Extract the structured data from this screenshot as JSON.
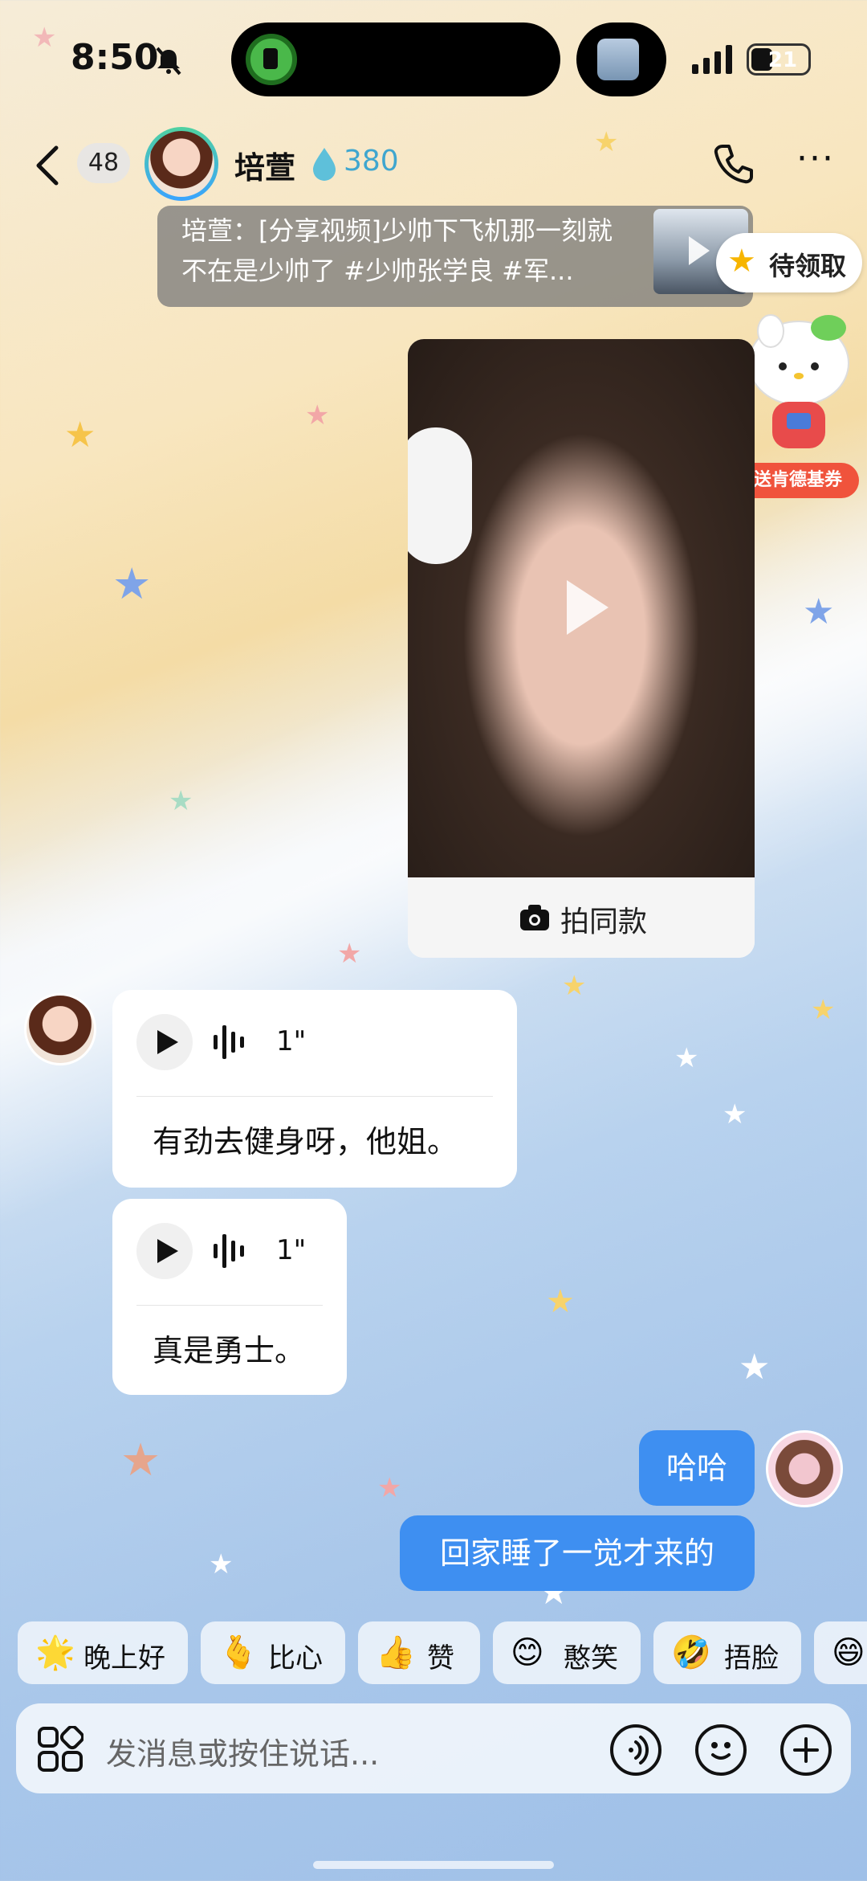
{
  "status_bar": {
    "time": "8:50",
    "battery": "21"
  },
  "header": {
    "unread_count": "48",
    "contact_name": "培萱",
    "spark_count": "380"
  },
  "shared_video": {
    "text": "培萱：[分享视频]少帅下飞机那一刻就不在是少帅了 #少帅张学良 #军..."
  },
  "promo": {
    "pending_label": "待领取",
    "coupon_label": "送肯德基券"
  },
  "video_message": {
    "action_label": "拍同款"
  },
  "messages": [
    {
      "sender": "contact",
      "type": "voice",
      "duration": "1\"",
      "transcript": "有劲去健身呀，他姐。"
    },
    {
      "sender": "contact",
      "type": "voice",
      "duration": "1\"",
      "transcript": "真是勇士。"
    },
    {
      "sender": "me",
      "type": "text",
      "text": "哈哈"
    },
    {
      "sender": "me",
      "type": "text",
      "text": "回家睡了一觉才来的"
    }
  ],
  "quick_replies": [
    {
      "emoji": "🌟",
      "label": "晚上好"
    },
    {
      "emoji": "🫰",
      "label": "比心"
    },
    {
      "emoji": "👍",
      "label": "赞"
    },
    {
      "emoji": "😊",
      "label": "憨笑"
    },
    {
      "emoji": "🤣",
      "label": "捂脸"
    },
    {
      "emoji": "😄",
      "label": ""
    }
  ],
  "input": {
    "placeholder": "发消息或按住说话..."
  },
  "colors": {
    "accent": "#3e8ff1",
    "spark": "#3fa6cf",
    "coupon": "#f0533c"
  }
}
